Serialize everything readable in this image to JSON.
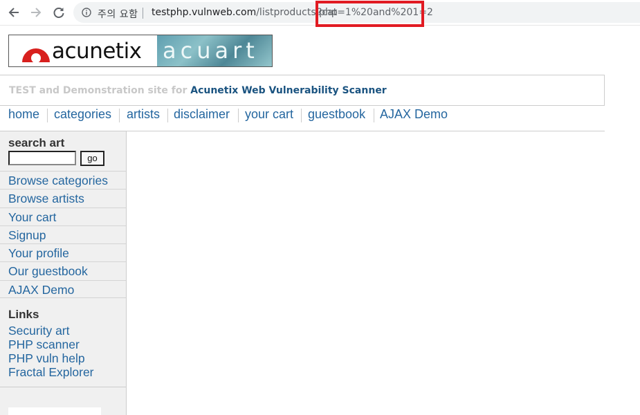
{
  "browser": {
    "security_label": "주의 요함",
    "url_host": "testphp.vulnweb.com",
    "url_path": "/listproducts.php",
    "url_query": "?cat=1%20and%201=2"
  },
  "header": {
    "logo_text": "acunetix",
    "logo_right_text": "acuart",
    "tagline_prefix": "TEST and Demonstration site for",
    "tagline_link": "Acunetix Web Vulnerability Scanner"
  },
  "menu": {
    "items": [
      {
        "label": "home"
      },
      {
        "label": "categories"
      },
      {
        "label": "artists"
      },
      {
        "label": "disclaimer"
      },
      {
        "label": "your cart"
      },
      {
        "label": "guestbook"
      },
      {
        "label": "AJAX Demo"
      }
    ]
  },
  "sidebar": {
    "search_title": "search art",
    "search_value": "",
    "go_label": "go",
    "items": [
      {
        "label": "Browse categories"
      },
      {
        "label": "Browse artists"
      },
      {
        "label": "Your cart"
      },
      {
        "label": "Signup"
      },
      {
        "label": "Your profile"
      },
      {
        "label": "Our guestbook"
      },
      {
        "label": "AJAX Demo"
      }
    ],
    "links_title": "Links",
    "links": [
      {
        "label": "Security art"
      },
      {
        "label": "PHP scanner"
      },
      {
        "label": "PHP vuln help"
      },
      {
        "label": "Fractal Explorer"
      }
    ]
  },
  "colors": {
    "highlight": "#e11b22",
    "link": "#24669f",
    "sidebar_bg": "#f0f0f0"
  }
}
